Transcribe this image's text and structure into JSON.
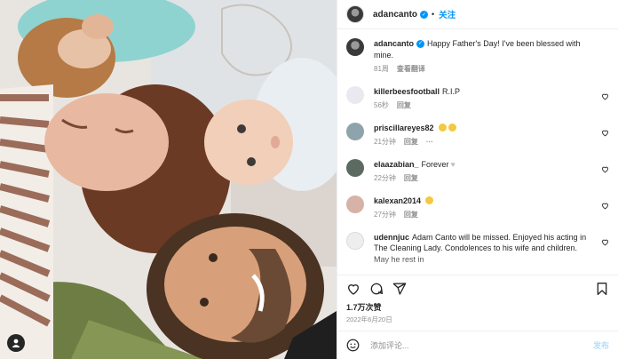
{
  "post": {
    "username": "adancanto",
    "follow_label": "关注",
    "more_icon": "more-horizontal-icon",
    "caption_user": "adancanto",
    "caption_text": "Happy Father's Day! I've been blessed with mine.",
    "caption_time": "81周",
    "caption_translate": "查看翻译"
  },
  "comments": [
    {
      "user": "killerbeesfootball",
      "text": "R.I.P",
      "likes": "56秒",
      "reply": "回复",
      "avatar_color": "#e9e9ef",
      "emoji": ""
    },
    {
      "user": "priscillareyes82",
      "text": "",
      "likes": "21分钟",
      "reply": "回复",
      "avatar_color": "#8fa3ad",
      "emoji": "crying-emoji x2",
      "more": "···"
    },
    {
      "user": "elaazabian_",
      "text": "Forever",
      "likes": "22分钟",
      "reply": "回复",
      "avatar_color": "#5b6b62",
      "emoji": "white-heart"
    },
    {
      "user": "kalexan2014",
      "text": "",
      "likes": "27分钟",
      "reply": "回复",
      "avatar_color": "#d7b2a6",
      "emoji": "crying-emoji"
    },
    {
      "user": "udennjuc",
      "text": "Adam Canto will be missed. Enjoyed his acting in The Cleaning Lady. Condolences to his wife and children. May he rest in",
      "likes": "",
      "reply": "",
      "avatar_color": "#eeeeee",
      "emoji": ""
    }
  ],
  "stats": {
    "likes": "1.7万次赞",
    "date": "2022年6月20日"
  },
  "composer": {
    "placeholder": "添加评论...",
    "post_label": "发布"
  },
  "colors": {
    "accent": "#0095f6",
    "muted": "#8e8e8e",
    "text": "#262626"
  }
}
